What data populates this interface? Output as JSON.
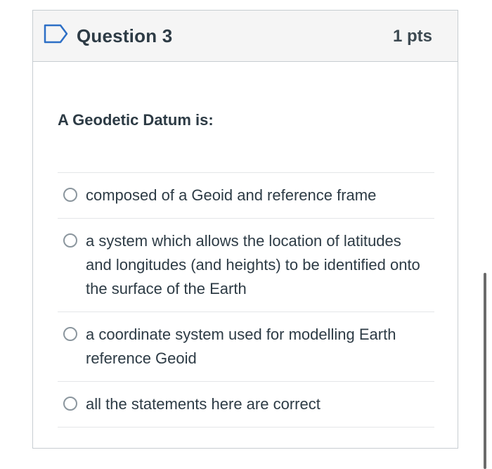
{
  "question": {
    "title": "Question 3",
    "points": "1 pts",
    "text": "A Geodetic Datum is:",
    "flag_icon": "flag-outline-icon",
    "accent_color": "#2d6fc6"
  },
  "answers": [
    {
      "label": "composed of a Geoid and reference frame",
      "selected": false
    },
    {
      "label": "a system which allows the location of latitudes and longitudes (and heights) to be identified onto the surface of the Earth",
      "selected": false
    },
    {
      "label": "a coordinate system used for modelling Earth reference Geoid",
      "selected": false
    },
    {
      "label": "all the statements here are correct",
      "selected": false
    }
  ]
}
